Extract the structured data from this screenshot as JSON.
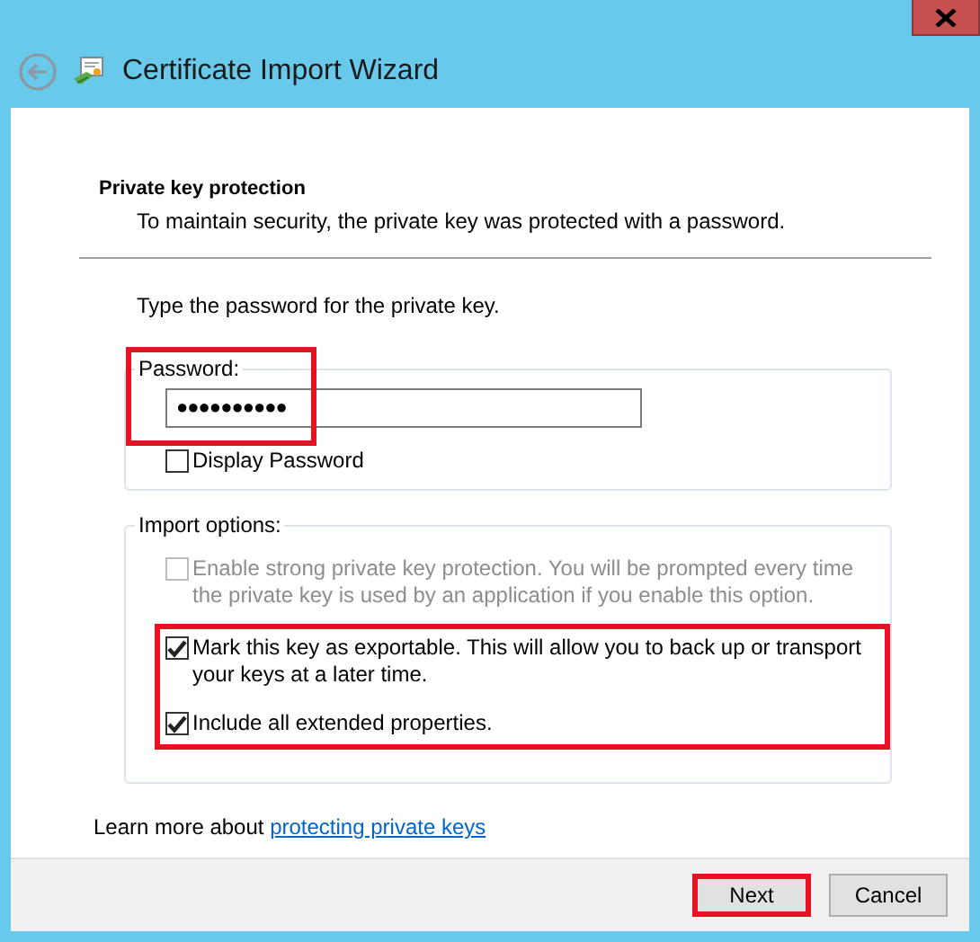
{
  "window": {
    "title": "Certificate Import Wizard"
  },
  "page": {
    "heading": "Private key protection",
    "description": "To maintain security, the private key was protected with a password."
  },
  "prompt": "Type the password for the private key.",
  "password_group": {
    "label": "Password:",
    "value": "●●●●●●●●●●",
    "highlighted": true,
    "display_password": {
      "label": "Display Password",
      "checked": false
    }
  },
  "import_options": {
    "label": "Import options:",
    "options": [
      {
        "label": "Enable strong private key protection. You will be prompted every time the private key is used by an application if you enable this option.",
        "checked": false,
        "disabled": true,
        "highlighted": false
      },
      {
        "label": "Mark this key as exportable. This will allow you to back up or transport your keys at a later time.",
        "checked": true,
        "disabled": false,
        "highlighted": true
      },
      {
        "label": "Include all extended properties.",
        "checked": true,
        "disabled": false,
        "highlighted": true
      }
    ]
  },
  "learn_more": {
    "text": "Learn more about",
    "link": "protecting private keys"
  },
  "buttons": [
    {
      "label": "Next",
      "highlighted": true
    },
    {
      "label": "Cancel",
      "highlighted": false
    }
  ]
}
